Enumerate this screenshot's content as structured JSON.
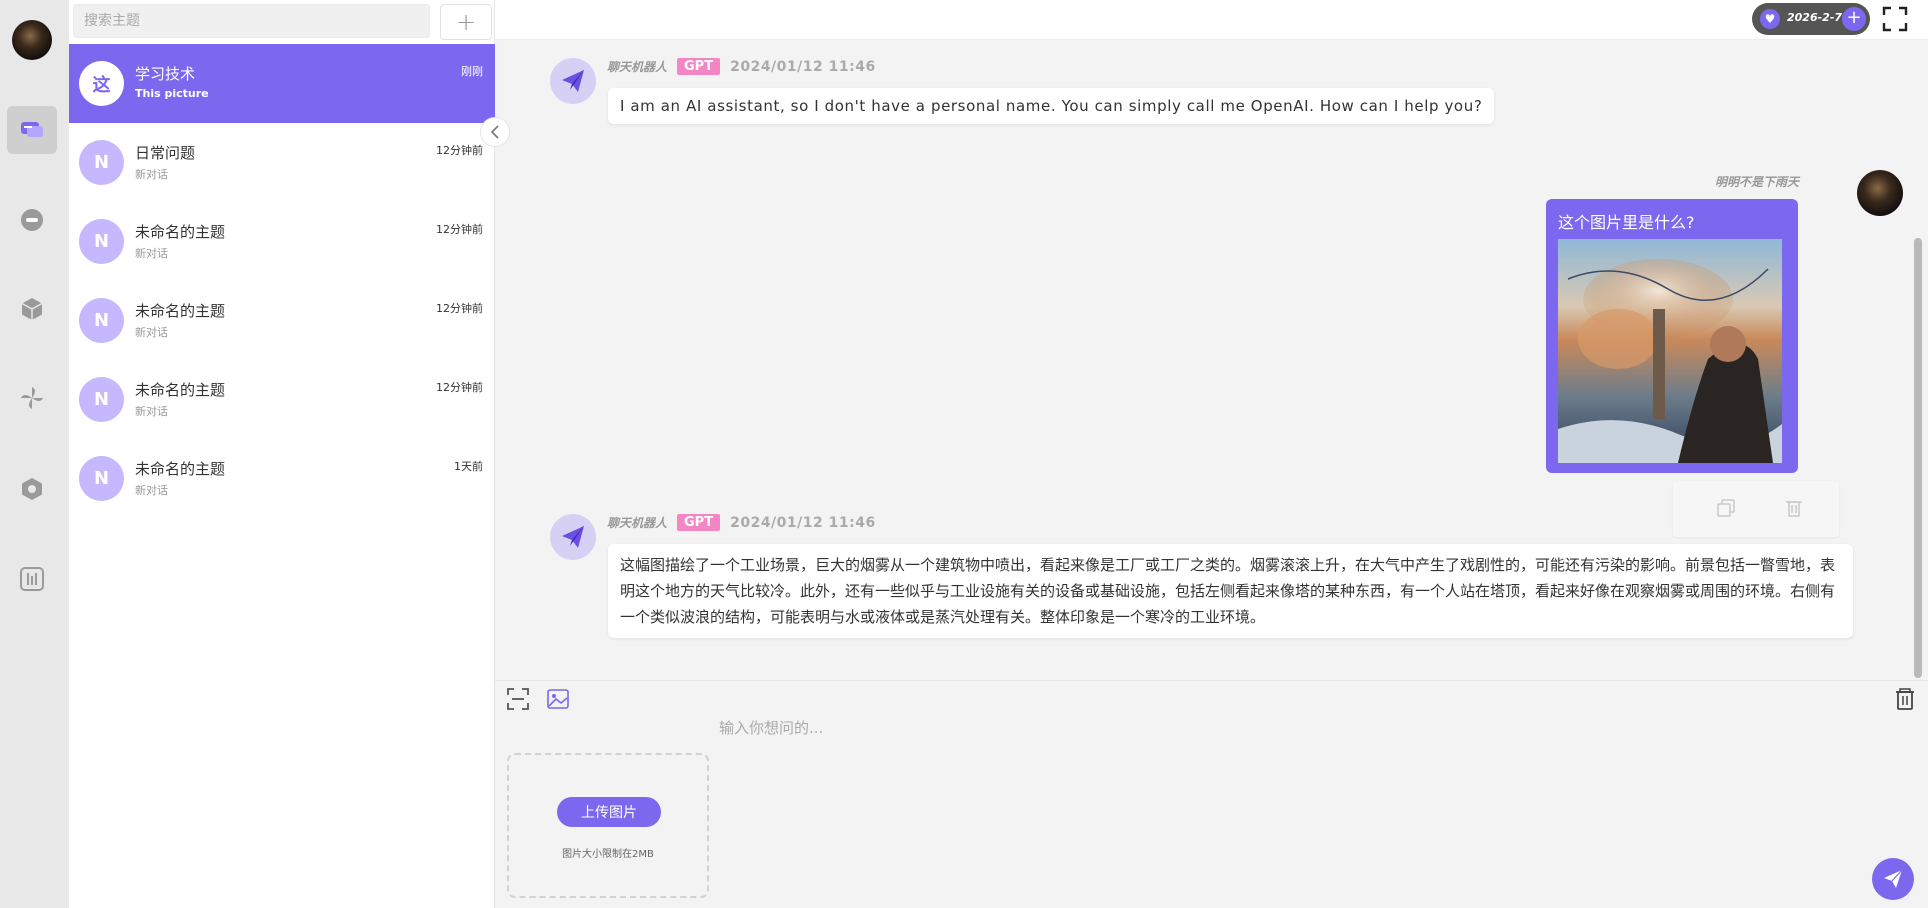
{
  "rail": {
    "icons": [
      "chat-icon",
      "robot-icon",
      "cube-icon",
      "pinwheel-icon",
      "hexagon-settings-icon",
      "sliders-icon"
    ]
  },
  "search": {
    "placeholder": "搜索主题",
    "add_label": "+"
  },
  "topics": [
    {
      "initial": "这",
      "title": "学习技术",
      "subtitle": "This picture",
      "time": "刚刚",
      "active": true
    },
    {
      "initial": "N",
      "title": "日常问题",
      "subtitle": "新对话",
      "time": "12分钟前",
      "active": false
    },
    {
      "initial": "N",
      "title": "未命名的主题",
      "subtitle": "新对话",
      "time": "12分钟前",
      "active": false
    },
    {
      "initial": "N",
      "title": "未命名的主题",
      "subtitle": "新对话",
      "time": "12分钟前",
      "active": false
    },
    {
      "initial": "N",
      "title": "未命名的主题",
      "subtitle": "新对话",
      "time": "12分钟前",
      "active": false
    },
    {
      "initial": "N",
      "title": "未命名的主题",
      "subtitle": "新对话",
      "time": "1天前",
      "active": false
    }
  ],
  "topbar": {
    "date": "2026-2-7",
    "plus": "+"
  },
  "messages": {
    "m1": {
      "sender": "聊天机器人",
      "model": "GPT",
      "time": "2024/01/12 11:46",
      "text": "I am an AI assistant, so I don't have a personal name. You can simply call me OpenAI. How can I help you?"
    },
    "m2": {
      "sender": "明明不是下雨天",
      "text": "这个图片里是什么?"
    },
    "m3": {
      "sender": "聊天机器人",
      "model": "GPT",
      "time": "2024/01/12 11:46",
      "text": "这幅图描绘了一个工业场景，巨大的烟雾从一个建筑物中喷出，看起来像是工厂或工厂之类的。烟雾滚滚上升，在大气中产生了戏剧性的，可能还有污染的影响。前景包括一瞥雪地，表明这个地方的天气比较冷。此外，还有一些似乎与工业设施有关的设备或基础设施，包括左侧看起来像塔的某种东西，有一个人站在塔顶，看起来好像在观察烟雾或周围的环境。右侧有一个类似波浪的结构，可能表明与水或液体或是蒸汽处理有关。整体印象是一个寒冷的工业环境。"
    }
  },
  "input": {
    "placeholder": "输入你想问的...",
    "upload_label": "上传图片",
    "upload_hint": "图片大小限制在2MB"
  },
  "colors": {
    "accent": "#7b68ee",
    "badge": "#f486c6"
  }
}
